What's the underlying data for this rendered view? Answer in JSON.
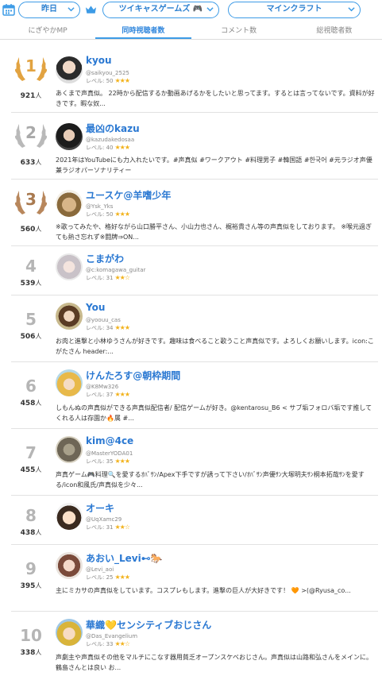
{
  "filters": {
    "period": "昨日",
    "category": "ツイキャスゲームズ 🎮",
    "game": "マインクラフト"
  },
  "tabs": [
    {
      "label": "にぎやかMP",
      "active": false
    },
    {
      "label": "同時視聴者数",
      "active": true
    },
    {
      "label": "コメント数",
      "active": false
    },
    {
      "label": "総視聴者数",
      "active": false
    }
  ],
  "colors": {
    "accent": "#3d9be6",
    "name": "#2a78d2",
    "star": "#f2b21b",
    "gold": "#e2a341",
    "silver": "#b9b9b9",
    "bronze": "#b8875c"
  },
  "rows": [
    {
      "rank": "1",
      "viewers": "921",
      "unit": "人",
      "name": "kyou",
      "userid": "@saikyou_2525",
      "level": "レベル: 50",
      "stars": "★★★",
      "desc": "あくまで声真似。 22時から配信するか動画あげるかをしたいと思ってます。するとは言ってないです。資料が好きです。暇な奴..."
    },
    {
      "rank": "2",
      "viewers": "633",
      "unit": "人",
      "name": "最凶のkazu",
      "userid": "@kazudakedosaa",
      "level": "レベル: 40",
      "stars": "★★★",
      "desc": "2021年はYouTubeにも力入れたいです。#声真似 #ワークアウト #料理男子 #韓国語 #한국어 #元ラジオ声優兼ラジオパーソナリティー"
    },
    {
      "rank": "3",
      "viewers": "560",
      "unit": "人",
      "name": "ユースケ@羊嗜少年",
      "userid": "@Ysk_Yks",
      "level": "レベル: 50",
      "stars": "★★★",
      "desc": "※歌ってみたや、格好ながら山口勝平さん、小山力也さん、梶裕貴さん等の声真似をしております。 ※喉元過ぎても熱さ忘れず※闘牌⇒ON..."
    },
    {
      "rank": "4",
      "viewers": "539",
      "unit": "人",
      "name": "こまがわ",
      "userid": "@c:komagawa_guitar",
      "level": "レベル: 31",
      "stars": "★★☆",
      "desc": ""
    },
    {
      "rank": "5",
      "viewers": "506",
      "unit": "人",
      "name": "You",
      "userid": "@yoouu_cas",
      "level": "レベル: 34",
      "stars": "★★★",
      "desc": "お肉と進撃と小林ゆうさんが好きです。趣味は食べること歌うこと声真似です。よろしくお願いします。icon:こがたさん header:..."
    },
    {
      "rank": "6",
      "viewers": "458",
      "unit": "人",
      "name": "けんたろす@朝枠期間",
      "userid": "@K8Mw326",
      "level": "レベル: 37",
      "stars": "★★★",
      "desc": "しもんぬの声真似ができる声真似配信者/ 配信ゲームが好き。@kentarosu_B6 < サブ垢フォロバ垢です推してくれる人は存園か🔥属 #..."
    },
    {
      "rank": "7",
      "viewers": "455",
      "unit": "人",
      "name": "kim@4ce",
      "userid": "@MasterYODA01",
      "level": "レベル: 35",
      "stars": "★★★",
      "desc": "声真ゲーム🎮料理🔍を愛するｵﾊﾞｻﾝ/Apex下手ですが誘って下さい/ｵﾊﾞｻﾝ声優ｻﾝ大塚明夫ｻﾝ桐本拓哉ｻﾝを愛する/icon和風氏/声真似を少々..."
    },
    {
      "rank": "8",
      "viewers": "438",
      "unit": "人",
      "name": "オーキ",
      "userid": "@UqXamc29",
      "level": "レベル: 31",
      "stars": "★★☆",
      "desc": ""
    },
    {
      "rank": "9",
      "viewers": "395",
      "unit": "人",
      "name": "あおい_Levi⊷🐎",
      "userid": "@Levi_aoi",
      "level": "レベル: 25",
      "stars": "★★★",
      "desc": "主にミカサの声真似をしています。コスプレもします。進撃の巨人が大好きです！ 🧡 >(@Ryusa_co..."
    },
    {
      "rank": "10",
      "viewers": "338",
      "unit": "人",
      "name": "華織💛センシティブおじさん",
      "userid": "@Das_Evangelium",
      "level": "レベル: 33",
      "stars": "★★☆",
      "desc": "声劇主や声真似その他をマルチにこなす器用貧乏オープンスケベおじさん。声真似は山路和弘さんをメインに。鶴島さんとは良い お..."
    }
  ]
}
